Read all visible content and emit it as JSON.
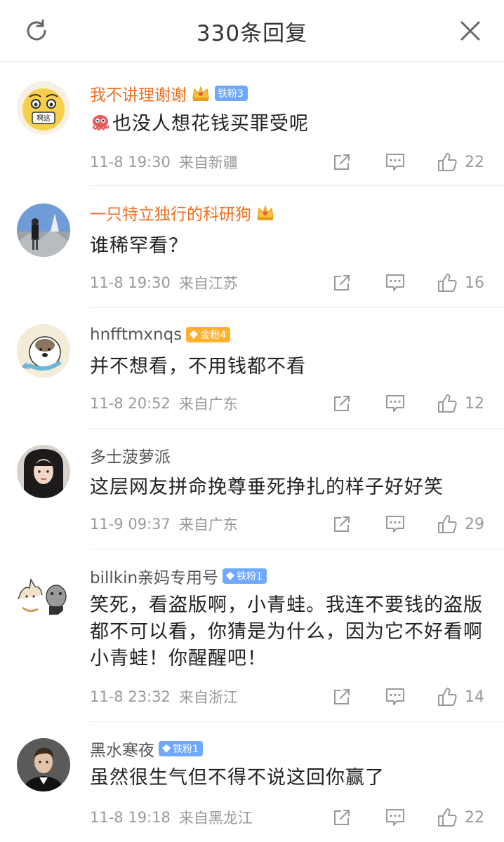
{
  "header": {
    "title": "330条回复",
    "refresh_icon": "refresh-icon",
    "close_icon": "close-icon"
  },
  "colors": {
    "vip_name": "#f26e1d",
    "normal_name": "#555555",
    "meta_text": "#999999",
    "tie_badge": "#6ea8ff",
    "jin_badge": "#ffb02e"
  },
  "comments": [
    {
      "username": "我不讲理谢谢",
      "vip": true,
      "crown": true,
      "badge": "铁粉3",
      "badge_type": "tie",
      "avatar_text": "啊这",
      "emoji": "octopus-emoji",
      "text": "也没人想花钱买罪受呢",
      "time": "11-8 19:30",
      "location": "来自新疆",
      "likes": "22"
    },
    {
      "username": "一只特立独行的科研狗",
      "vip": true,
      "crown": true,
      "badge": "",
      "badge_type": "",
      "text": "谁稀罕看？",
      "time": "11-8 19:30",
      "location": "来自江苏",
      "likes": "16"
    },
    {
      "username": "hnfftmxnqs",
      "vip": false,
      "crown": false,
      "badge": "金粉4",
      "badge_type": "jin",
      "text": "并不想看，不用钱都不看",
      "time": "11-8 20:52",
      "location": "来自广东",
      "likes": "12"
    },
    {
      "username": "多士菠萝派",
      "vip": false,
      "crown": false,
      "badge": "",
      "badge_type": "",
      "text": "这层网友拼命挽尊垂死挣扎的样子好好笑",
      "time": "11-9 09:37",
      "location": "来自广东",
      "likes": "29"
    },
    {
      "username": "billkin亲妈专用号",
      "vip": false,
      "crown": false,
      "badge": "铁粉1",
      "badge_type": "tie",
      "text": "笑死，看盗版啊，小青蛙。我连不要钱的盗版都不可以看，你猜是为什么，因为它不好看啊小青蛙！你醒醒吧！",
      "time": "11-8 23:32",
      "location": "来自浙江",
      "likes": "14"
    },
    {
      "username": "黑水寒夜",
      "vip": false,
      "crown": false,
      "badge": "铁粉1",
      "badge_type": "tie",
      "text": "虽然很生气但不得不说这回你赢了",
      "time": "11-8 19:18",
      "location": "来自黑龙江",
      "likes": "22"
    }
  ]
}
